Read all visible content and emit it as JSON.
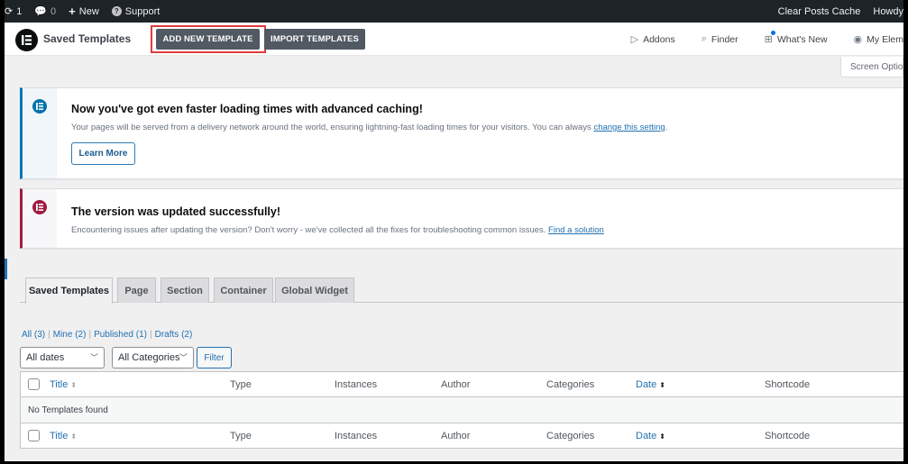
{
  "admin_bar": {
    "updates_count": "1",
    "comments_count": "0",
    "new_label": "New",
    "support_label": "Support",
    "clear_cache_label": "Clear Posts Cache",
    "howdy_label": "Howdy"
  },
  "header": {
    "title": "Saved Templates",
    "add_new_label": "ADD NEW TEMPLATE",
    "import_label": "IMPORT TEMPLATES",
    "links": [
      {
        "label": "Addons",
        "icon": "addons-icon"
      },
      {
        "label": "Finder",
        "icon": "search-icon"
      },
      {
        "label": "What's New",
        "icon": "gift-icon"
      },
      {
        "label": "My Elem",
        "icon": "user-circle-icon"
      }
    ],
    "highlight_color": "#e03c3c"
  },
  "screen_options_label": "Screen Options",
  "notices": {
    "caching": {
      "title": "Now you've got even faster loading times with advanced caching!",
      "text": "Your pages will be served from a delivery network around the world, ensuring lightning-fast loading times for your visitors. You can always ",
      "link": "change this setting",
      "suffix": ".",
      "button": "Learn More",
      "accent": "#0077b5"
    },
    "update": {
      "title": "The version was updated successfully!",
      "text": "Encountering issues after updating the version? Don't worry - we've collected all the fixes for troubleshooting common issues. ",
      "link": "Find a solution",
      "accent": "#9f1c3f"
    }
  },
  "tabs": [
    {
      "label": "Saved Templates",
      "active": true
    },
    {
      "label": "Page",
      "active": false
    },
    {
      "label": "Section",
      "active": false
    },
    {
      "label": "Container",
      "active": false
    },
    {
      "label": "Global Widget",
      "active": false
    }
  ],
  "views": [
    {
      "label": "All",
      "count": "(3)"
    },
    {
      "label": "Mine",
      "count": "(2)"
    },
    {
      "label": "Published",
      "count": "(1)"
    },
    {
      "label": "Drafts",
      "count": "(2)"
    }
  ],
  "filters": {
    "date_selected": "All dates",
    "category_selected": "All Categories",
    "filter_button": "Filter"
  },
  "table": {
    "columns": {
      "title": "Title",
      "type": "Type",
      "instances": "Instances",
      "author": "Author",
      "categories": "Categories",
      "date": "Date",
      "shortcode": "Shortcode"
    },
    "empty_message": "No Templates found"
  }
}
